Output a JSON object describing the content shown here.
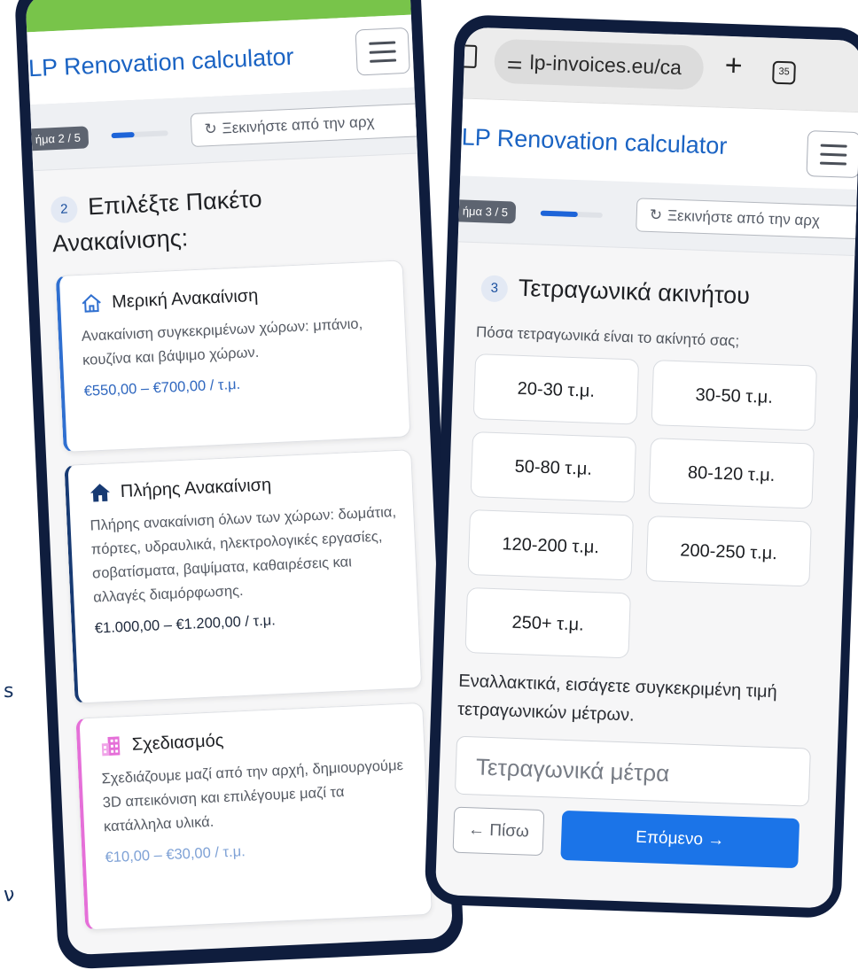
{
  "edge_letters": {
    "top": "s",
    "bottom": "ν"
  },
  "left_phone": {
    "brand": "LP Renovation calculator",
    "step_pill": "ήμα 2 / 5",
    "restart_label": "Ξεκινήστε από την αρχ",
    "progress": 0.4,
    "section_number": "2",
    "section_title_line1": "Επιλέξτε Πακέτο",
    "section_title_line2": "Ανακαίνισης:",
    "cards": [
      {
        "title": "Μερική Ανακαίνιση",
        "desc": "Ανακαίνιση συγκεκριμένων χώρων: μπάνιο, κουζίνα και βάψιμο χώρων.",
        "price": "€550,00 – €700,00 / τ.μ.",
        "icon": "house-outline-icon",
        "accent": "#2f6fd0"
      },
      {
        "title": "Πλήρης Ανακαίνιση",
        "desc": "Πλήρης ανακαίνιση όλων των χώρων: δωμάτια, πόρτες, υδραυλικά, ηλεκτρολογικές εργασίες, σοβατίσματα, βαψίματα, καθαιρέσεις και αλλαγές διαμόρφωσης.",
        "price": "€1.000,00 – €1.200,00 / τ.μ.",
        "icon": "house-solid-icon",
        "accent": "#173a73"
      },
      {
        "title": "Σχεδιασμός",
        "desc": "Σχεδιάζουμε μαζί από την αρχή, δημιουργούμε 3D απεικόνιση και επιλέγουμε μαζί τα κατάλληλα υλικά.",
        "price": "€10,00 – €30,00 / τ.μ.",
        "icon": "building-icon",
        "accent": "#e56fd8"
      }
    ]
  },
  "right_phone": {
    "browser": {
      "url": "lp-invoices.eu/ca",
      "tab_count": "35",
      "new_tab": "+"
    },
    "brand": "LP Renovation calculator",
    "step_pill": "ήμα 3 / 5",
    "restart_label": "Ξεκινήστε από την αρχ",
    "progress": 0.6,
    "section_number": "3",
    "section_title": "Τετραγωνικά ακινήτου",
    "question": "Πόσα τετραγωνικά είναι το ακίνητό σας;",
    "options": [
      "20-30 τ.μ.",
      "30-50 τ.μ.",
      "50-80 τ.μ.",
      "80-120 τ.μ.",
      "120-200 τ.μ.",
      "200-250 τ.μ.",
      "250+ τ.μ."
    ],
    "alt_text": "Εναλλακτικά, εισάγετε συγκεκριμένη τιμή τετραγωνικών μέτρων.",
    "input_placeholder": "Τετραγωνικά μέτρα",
    "back_label": "← Πίσω",
    "next_label": "Επόμενο →"
  }
}
